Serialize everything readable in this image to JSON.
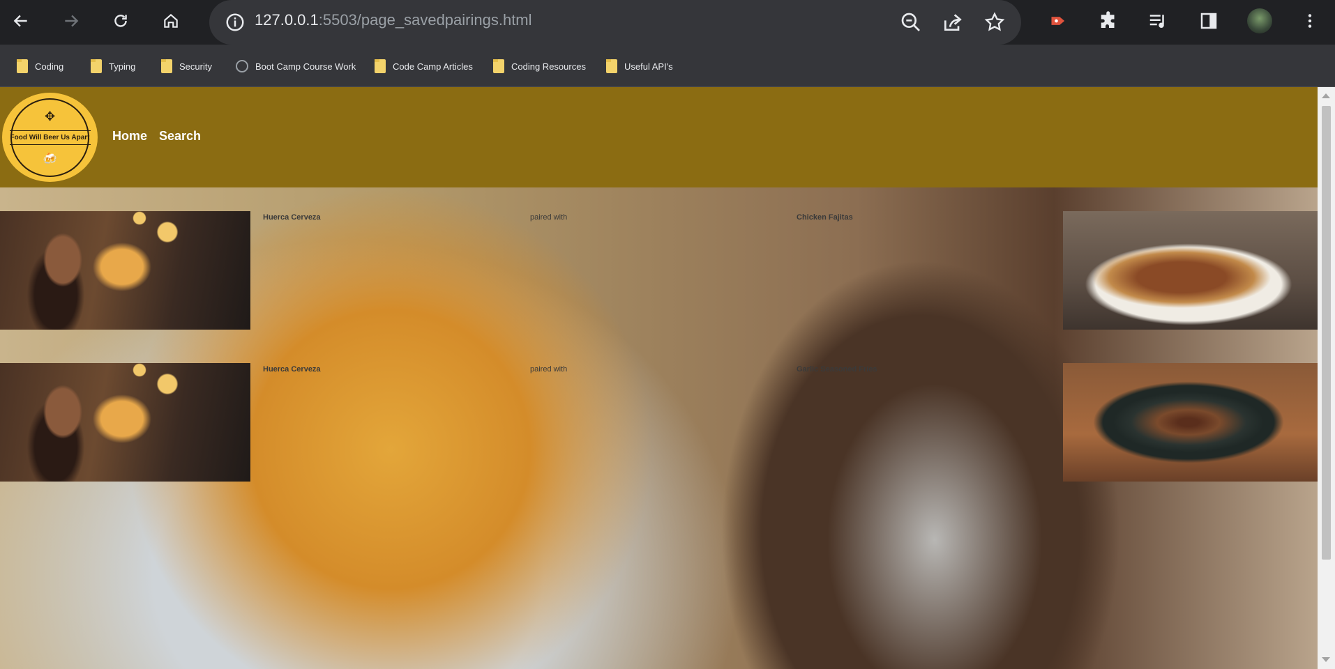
{
  "browser": {
    "url_host": "127.0.0.1",
    "url_rest": ":5503/page_savedpairings.html",
    "bookmarks": [
      {
        "label": "Coding",
        "icon": "folder-icon"
      },
      {
        "label": "Typing",
        "icon": "folder-icon"
      },
      {
        "label": "Security",
        "icon": "folder-icon"
      },
      {
        "label": "Boot Camp Course Work",
        "icon": "github-icon"
      },
      {
        "label": "Code Camp Articles",
        "icon": "folder-icon"
      },
      {
        "label": "Coding Resources",
        "icon": "folder-icon"
      },
      {
        "label": "Useful API's",
        "icon": "folder-icon"
      }
    ]
  },
  "site": {
    "logo_text": "Food Will Beer Us Apart",
    "nav": {
      "home": "Home",
      "search": "Search"
    },
    "header_color": "#8b6c12"
  },
  "pairings": [
    {
      "beer": "Huerca Cerveza",
      "connector": "paired with",
      "food": "Chicken Fajitas"
    },
    {
      "beer": "Huerca Cerveza",
      "connector": "paired with",
      "food": "Garlic Seasoned Fries"
    }
  ]
}
